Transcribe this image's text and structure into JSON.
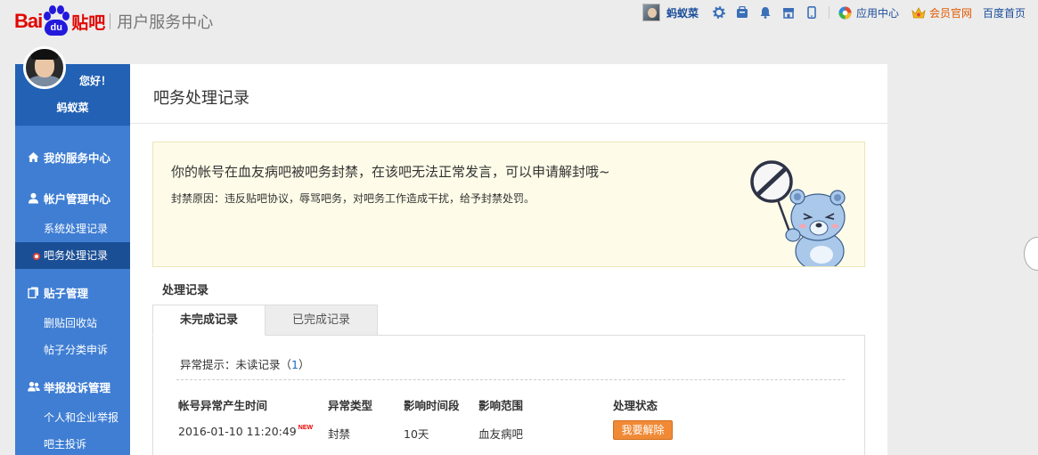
{
  "brand": {
    "logo_left": "Bai",
    "logo_paw": "du",
    "logo_tieba": "贴吧",
    "subtitle": "用户服务中心"
  },
  "topnav": {
    "username": "蚂蚁菜",
    "icons": [
      "gear-icon",
      "messages-icon",
      "bell-icon",
      "store-icon",
      "mobile-icon"
    ],
    "app_center": "应用中心",
    "member": "会员官网",
    "home": "百度首页"
  },
  "sidebar": {
    "greeting": "您好！",
    "username": "蚂蚁菜",
    "sections": [
      {
        "label": "我的服务中心",
        "icon": "home-icon",
        "items": []
      },
      {
        "label": "帐户管理中心",
        "icon": "user-icon",
        "items": [
          "系统处理记录",
          "吧务处理记录"
        ]
      },
      {
        "label": "贴子管理",
        "icon": "document-icon",
        "items": [
          "删贴回收站",
          "帖子分类申诉"
        ]
      },
      {
        "label": "举报投诉管理",
        "icon": "users-icon",
        "items": [
          "个人和企业举报",
          "吧主投诉"
        ]
      }
    ],
    "active_item": "吧务处理记录"
  },
  "main": {
    "title": "吧务处理记录",
    "notice": {
      "message": "你的帐号在血友病吧被吧务封禁，在该吧无法正常发言，可以申请解封哦~",
      "reason": "封禁原因：违反贴吧协议，辱骂吧务，对吧务工作造成干扰，给予封禁处罚。"
    },
    "records_title": "处理记录",
    "tabs": [
      {
        "label": "未完成记录",
        "active": true
      },
      {
        "label": "已完成记录",
        "active": false
      }
    ],
    "alert": {
      "prefix": "异常提示：未读记录（",
      "count": "1",
      "suffix": "）"
    },
    "table": {
      "headers": [
        "帐号异常产生时间",
        "异常类型",
        "影响时间段",
        "影响范围",
        "处理状态"
      ],
      "rows": [
        {
          "time": "2016-01-10 11:20:49",
          "badge": "NEW",
          "type": "封禁",
          "duration": "10天",
          "scope": "血友病吧",
          "action": "我要解除"
        }
      ]
    }
  },
  "colors": {
    "sidebar_bg": "#3f7ed3",
    "sidebar_active": "#1b4f95",
    "notice_bg": "#fefce8",
    "action_button": "#f08a36",
    "link": "#1a4d99",
    "brand_red": "#e10601",
    "brand_blue": "#2319dc"
  }
}
